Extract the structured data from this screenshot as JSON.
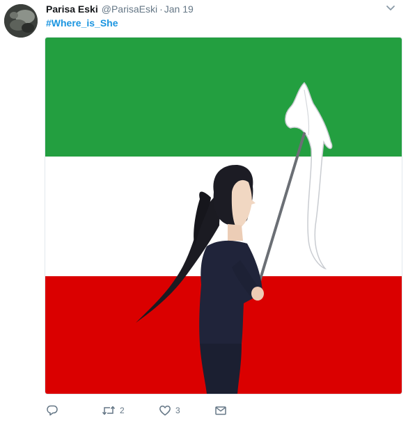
{
  "tweet": {
    "author": {
      "display_name": "Parisa Eski",
      "handle": "@ParisaEski"
    },
    "separator": "·",
    "date": "Jan 19",
    "text": "#Where_is_She",
    "media": {
      "description_icon": "flag-illustration",
      "colors": {
        "green": "#239f40",
        "white": "#ffffff",
        "red": "#da0000"
      }
    },
    "actions": {
      "reply_icon": "reply-icon",
      "retweet_icon": "retweet-icon",
      "retweet_count": "2",
      "like_icon": "heart-icon",
      "like_count": "3",
      "message_icon": "envelope-icon"
    }
  }
}
